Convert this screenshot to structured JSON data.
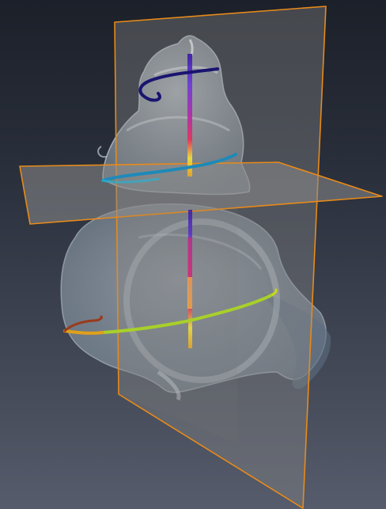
{
  "viewer": {
    "background_top": "#1c2029",
    "background_bottom": "#565c6b",
    "plane_outline_color": "#e88a1a",
    "plane_fill_color": "#8a8a8a",
    "shell_color": "#c4d0d8",
    "axis_gradient": [
      "#3a18a8",
      "#6a3ad8",
      "#b02aa8",
      "#e8305a",
      "#f0e23a"
    ],
    "spiral_gradient": [
      "#1a1470",
      "#2a1e98",
      "#1e8ab8",
      "#2ab0d0",
      "#a8d02a",
      "#e8d21a",
      "#e09018",
      "#9a3a1a"
    ]
  },
  "objects": [
    {
      "name": "shell-model-icon"
    },
    {
      "name": "vertical-slice-plane"
    },
    {
      "name": "horizontal-slice-plane"
    },
    {
      "name": "second-slice-plane"
    },
    {
      "name": "coiling-axis-line"
    },
    {
      "name": "suture-spiral-line"
    }
  ]
}
